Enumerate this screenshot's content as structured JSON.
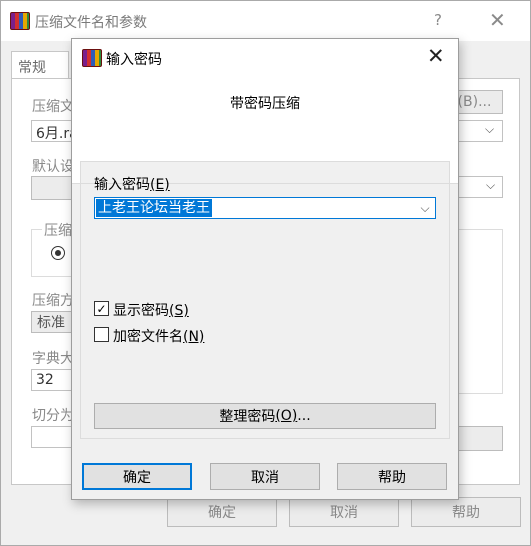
{
  "parent": {
    "title": "压缩文件名和参数",
    "help_glyph": "?",
    "close_glyph": "✕",
    "tab_general": "常规",
    "archive_name_label": "压缩文",
    "archive_name_value": "6月.ra",
    "browse_label": "(B)...",
    "default_label": "默认设",
    "format_label": "压缩",
    "method_label": "压缩方",
    "method_value": "标准",
    "dict_label": "字典大",
    "dict_value": "32",
    "split_label": "切分为",
    "ok_label": "确定",
    "cancel_label": "取消",
    "help_label": "帮助",
    "chevron": "⌵"
  },
  "dialog": {
    "title": "输入密码",
    "close_glyph": "✕",
    "heading": "带密码压缩",
    "password_label": "输入密码",
    "password_label_key": "(E)",
    "password_value": "上老王论坛当老王",
    "dropdown_glyph": "⌵",
    "show_password": {
      "label": "显示密码",
      "key": "(S)",
      "checked": true,
      "check_glyph": "✓"
    },
    "encrypt_filenames": {
      "label": "加密文件名",
      "key": "(N)",
      "checked": false
    },
    "organize_button": "整理密码",
    "organize_key": "(O)",
    "organize_suffix": "...",
    "ok_label": "确定",
    "cancel_label": "取消",
    "help_label": "帮助"
  }
}
